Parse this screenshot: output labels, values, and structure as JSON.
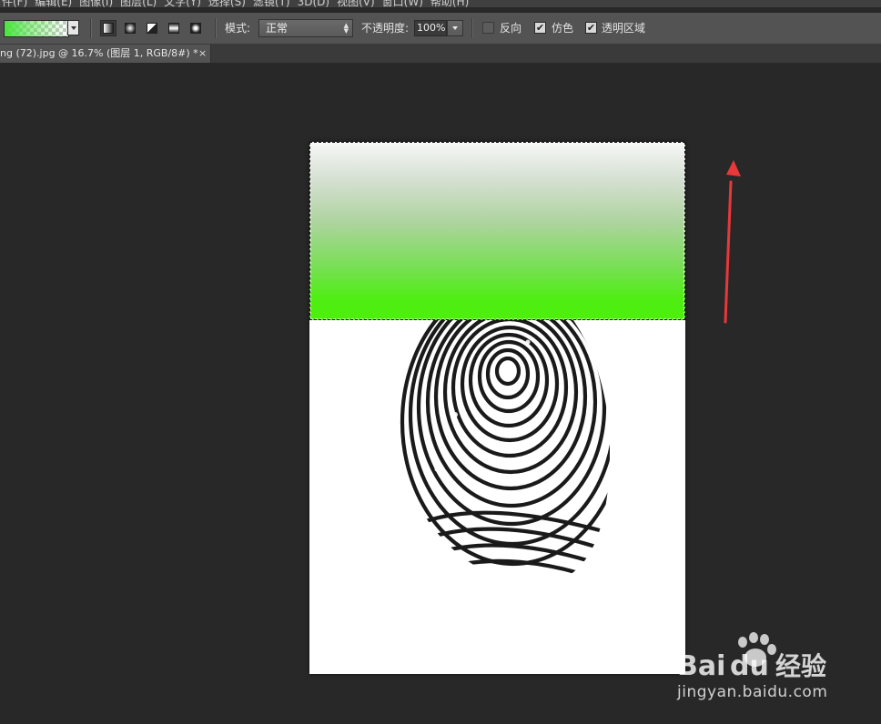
{
  "menubar": {
    "items": [
      "件(F)",
      "编辑(E)",
      "图像(I)",
      "图层(L)",
      "文字(Y)",
      "选择(S)",
      "滤镜(T)",
      "3D(D)",
      "视图(V)",
      "窗口(W)",
      "帮助(H)"
    ]
  },
  "options_bar": {
    "gradient_preview_colors": [
      "#48e43c",
      "transparent"
    ],
    "gradient_types": [
      "linear-gradient-icon",
      "radial-gradient-icon",
      "angle-gradient-icon",
      "reflected-gradient-icon",
      "diamond-gradient-icon"
    ],
    "active_gradient_type": "linear-gradient-icon",
    "mode_label": "模式:",
    "mode_value": "正常",
    "opacity_label": "不透明度:",
    "opacity_value": "100%",
    "reverse_label": "反向",
    "reverse_checked": false,
    "dither_label": "仿色",
    "dither_checked": true,
    "transparency_label": "透明区域",
    "transparency_checked": true
  },
  "document": {
    "tab_title": "ng (72).jpg @ 16.7% (图层 1, RGB/8#) *",
    "tab_close": "×",
    "gradient_colors": [
      "#f7f7f7",
      "#4bf00a"
    ],
    "annotation_arrow_color": "#e8383a"
  },
  "watermark": {
    "brand": "Bai",
    "brand_suffix": "du",
    "product": "经验",
    "url": "jingyan.baidu.com"
  }
}
